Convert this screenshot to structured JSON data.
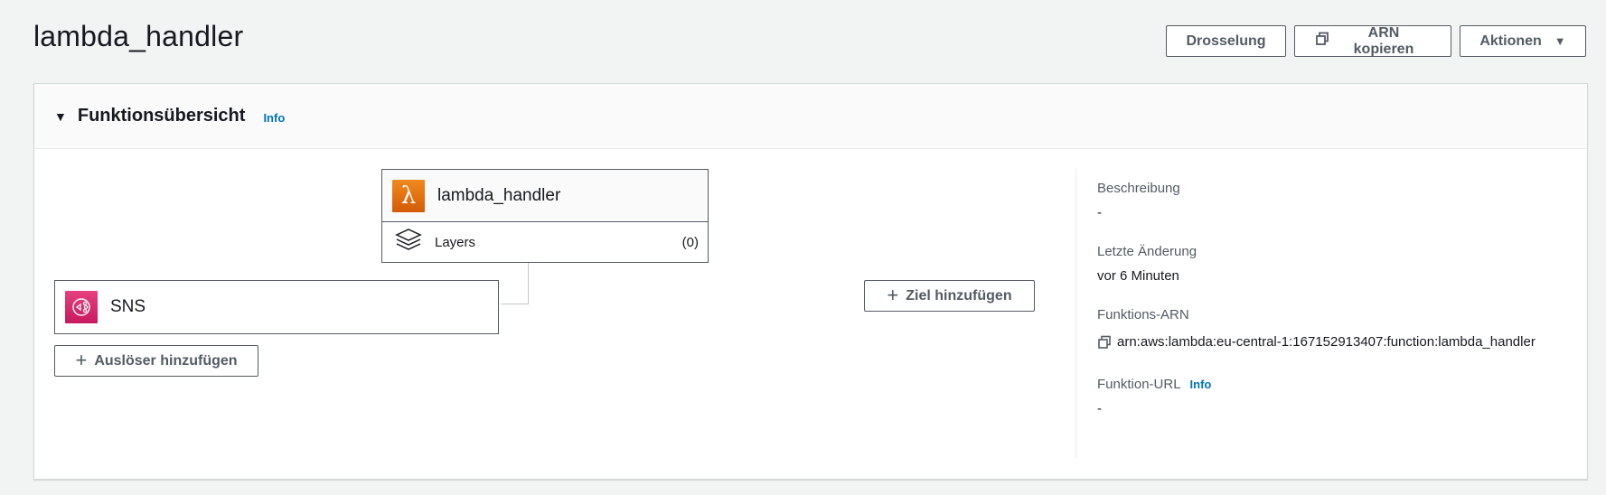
{
  "page": {
    "title": "lambda_handler"
  },
  "header_actions": {
    "throttle_label": "Drosselung",
    "copy_arn_label": "ARN kopieren",
    "actions_label": "Aktionen",
    "actions_caret": "▼"
  },
  "panel": {
    "title": "Funktionsübersicht",
    "info_label": "Info",
    "collapse_icon": "▼"
  },
  "function_node": {
    "icon": "λ",
    "name": "lambda_handler",
    "layers_label": "Layers",
    "layers_count": "(0)"
  },
  "trigger_node": {
    "name": "SNS"
  },
  "buttons": {
    "add_trigger_label": "Auslöser hinzufügen",
    "add_destination_label": "Ziel hinzufügen",
    "plus": "+"
  },
  "details": {
    "description_label": "Beschreibung",
    "description_value": "-",
    "last_modified_label": "Letzte Änderung",
    "last_modified_value": "vor 6 Minuten",
    "arn_label": "Funktions-ARN",
    "arn_value": "arn:aws:lambda:eu-central-1:167152913407:function:lambda_handler",
    "url_label": "Funktion-URL",
    "url_info_label": "Info",
    "url_value": "-"
  },
  "colors": {
    "link": "#0073bb",
    "lambda_orange": "#f08a1e",
    "sns_pink": "#e7417f",
    "button_text": "#545b64"
  }
}
